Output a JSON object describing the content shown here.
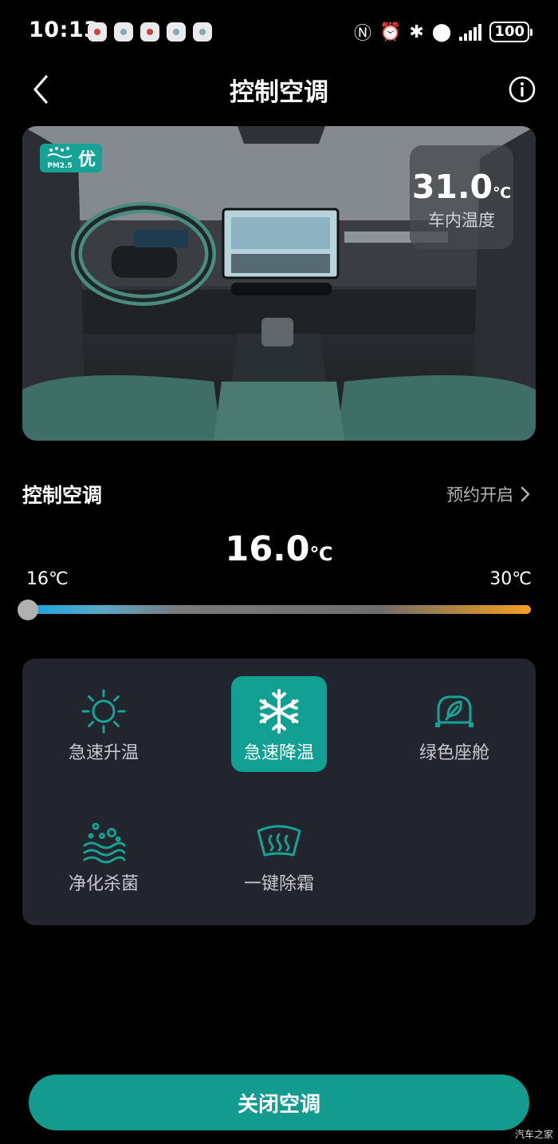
{
  "status_bar": {
    "time": "10:13",
    "battery": "100",
    "icons": [
      "nfc-icon",
      "alarm-icon",
      "bluetooth-icon",
      "location-icon",
      "signal-icon"
    ]
  },
  "header": {
    "title": "控制空调",
    "back_icon": "chevron-left-icon",
    "info_icon": "info-icon"
  },
  "cabin": {
    "air_quality_label": "优",
    "air_quality_icon": "pm25-icon",
    "temperature_value": "31.0",
    "temperature_unit": "℃",
    "temperature_label": "车内温度"
  },
  "control": {
    "section_title": "控制空调",
    "schedule_label": "预约开启",
    "setpoint_value": "16.0",
    "setpoint_unit": "℃",
    "min_label": "16℃",
    "max_label": "30℃",
    "slider": {
      "min": 16,
      "max": 30,
      "value": 16
    }
  },
  "modes": [
    {
      "label": "急速升温",
      "icon": "sun-icon",
      "active": false
    },
    {
      "label": "急速降温",
      "icon": "snowflake-icon",
      "active": true
    },
    {
      "label": "绿色座舱",
      "icon": "green-cabin-icon",
      "active": false
    },
    {
      "label": "净化杀菌",
      "icon": "purify-icon",
      "active": false
    },
    {
      "label": "一键除霜",
      "icon": "defrost-icon",
      "active": false
    }
  ],
  "actions": {
    "close_label": "关闭空调"
  },
  "watermark": "汽车之家",
  "colors": {
    "accent": "#12a093",
    "slider_cold": "#1ca4e0",
    "slider_hot": "#f6a022",
    "panel": "#22252e"
  }
}
